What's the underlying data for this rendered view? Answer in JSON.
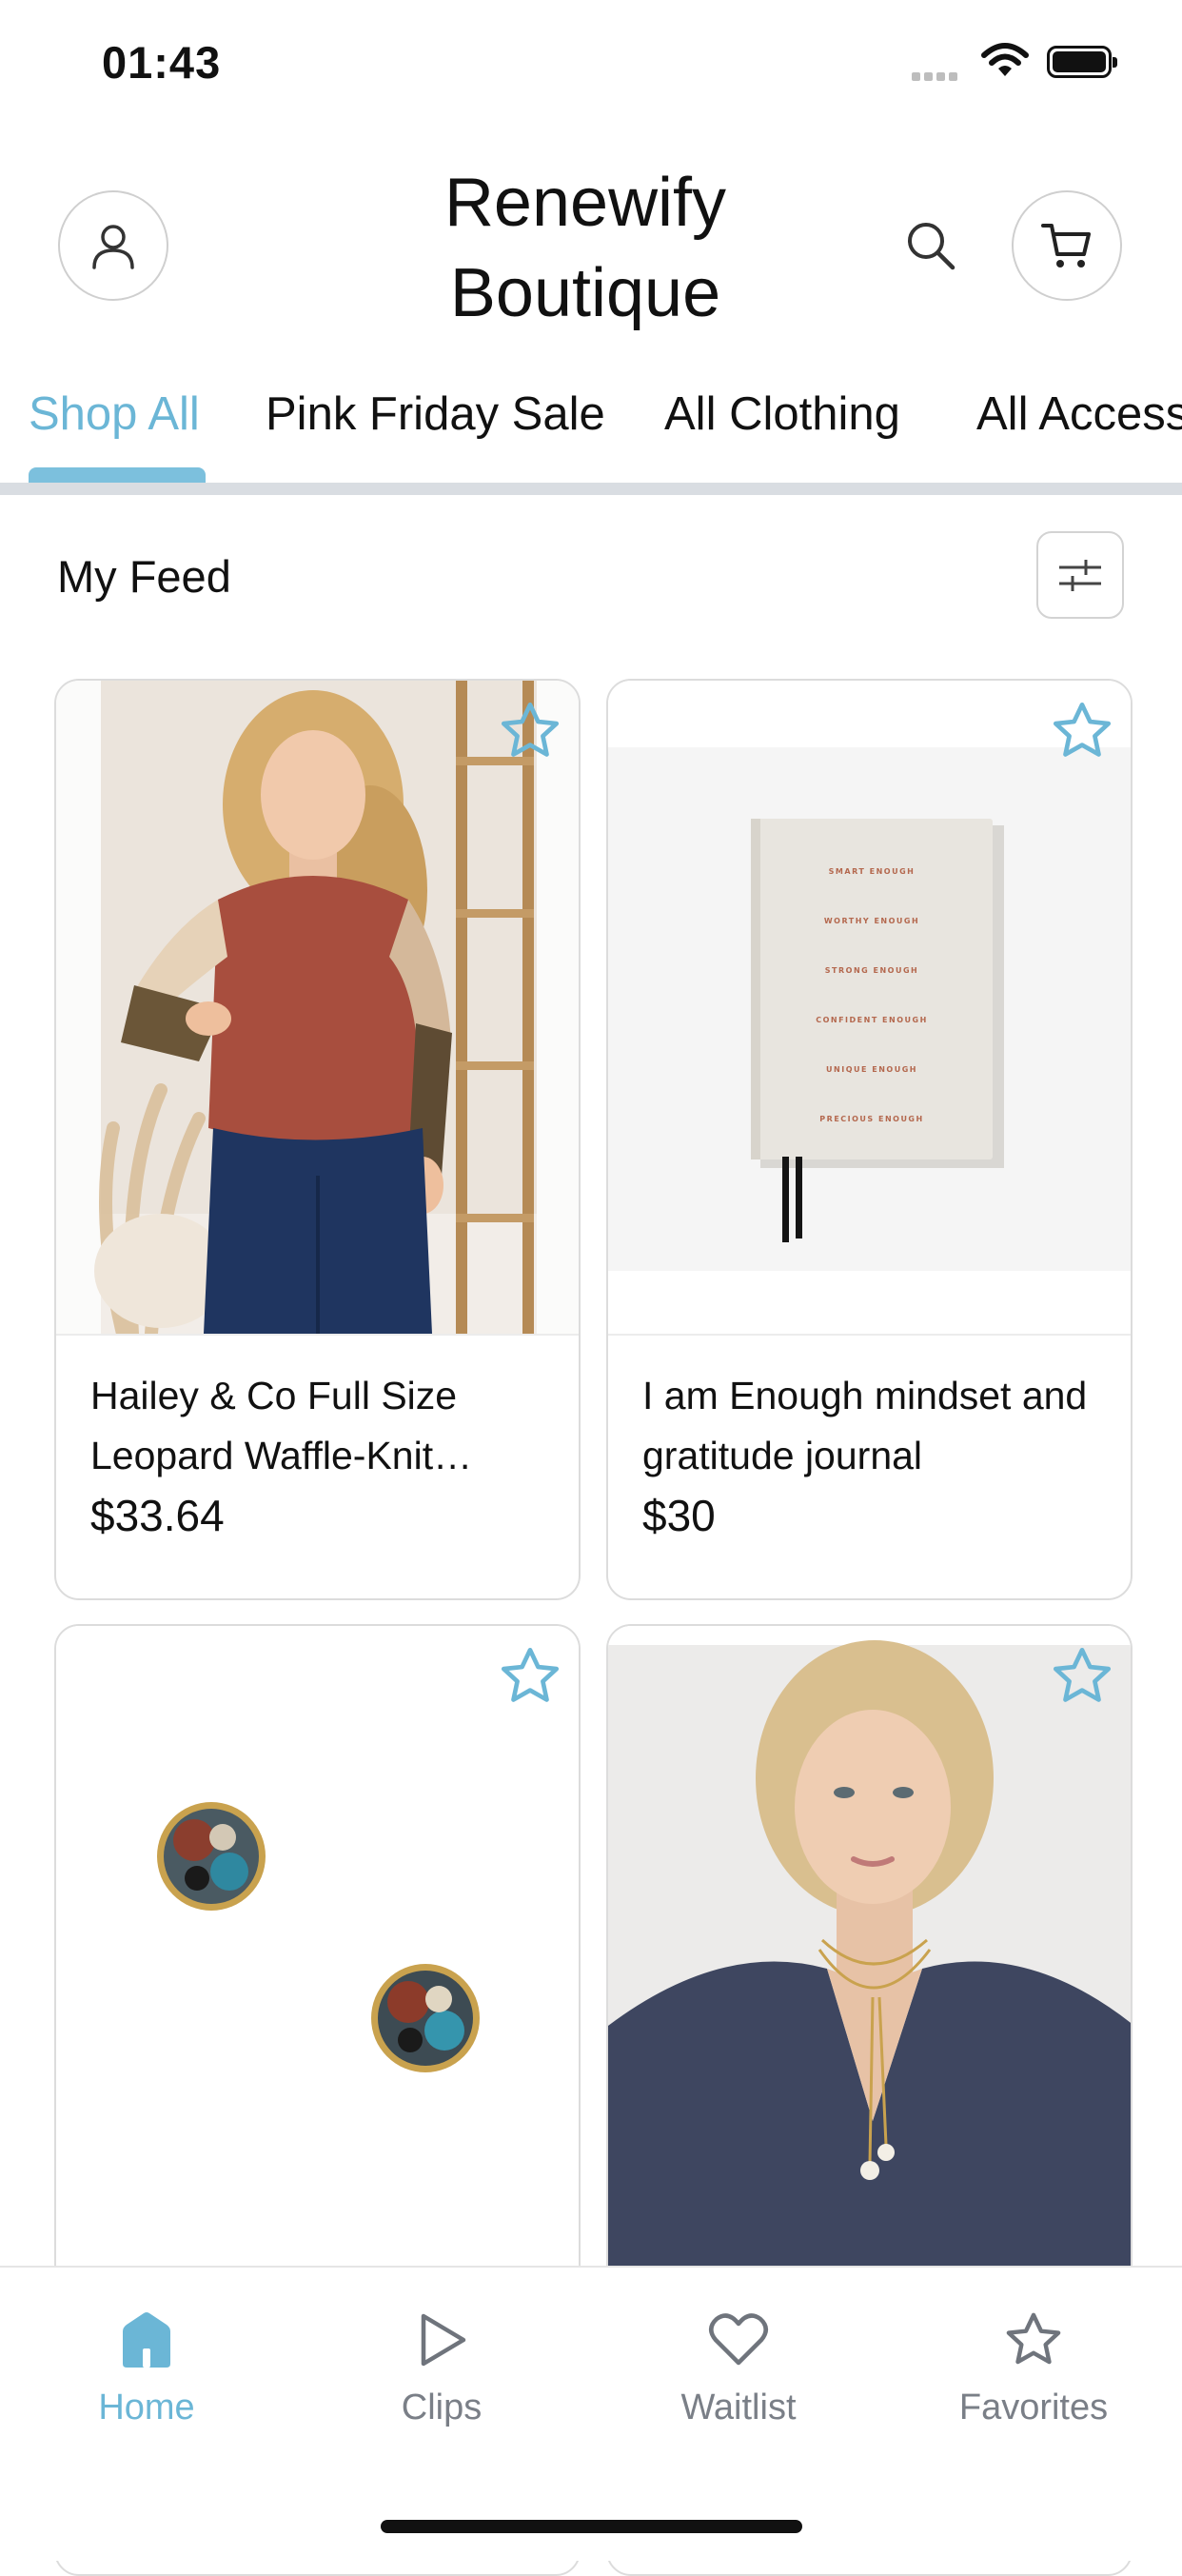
{
  "status_bar": {
    "time": "01:43"
  },
  "header": {
    "brand_line1": "Renewify",
    "brand_line2": "Boutique",
    "icons": [
      "profile-icon",
      "search-icon",
      "cart-icon"
    ]
  },
  "tabs": [
    {
      "label": "Shop All",
      "active": true
    },
    {
      "label": "Pink Friday Sale",
      "active": false
    },
    {
      "label": "All Clothing",
      "active": false
    },
    {
      "label": "All Accessories",
      "active": false
    }
  ],
  "feed": {
    "title": "My Feed"
  },
  "products": [
    {
      "name": "Hailey & Co Full Size Leopard Waffle-Knit…",
      "price": "$33.64"
    },
    {
      "name": "I am Enough mindset and gratitude journal",
      "price": "$30"
    },
    {
      "name": "",
      "price": ""
    },
    {
      "name": "",
      "price": ""
    }
  ],
  "journal_cover": [
    "SMART ENOUGH",
    "WORTHY ENOUGH",
    "STRONG ENOUGH",
    "CONFIDENT ENOUGH",
    "UNIQUE ENOUGH",
    "PRECIOUS ENOUGH"
  ],
  "bottom_nav": [
    {
      "label": "Home",
      "active": true
    },
    {
      "label": "Clips",
      "active": false
    },
    {
      "label": "Waitlist",
      "active": false
    },
    {
      "label": "Favorites",
      "active": false
    }
  ],
  "colors": {
    "accent": "#6bb6d6",
    "text": "#111111",
    "muted": "#7a7f87"
  }
}
